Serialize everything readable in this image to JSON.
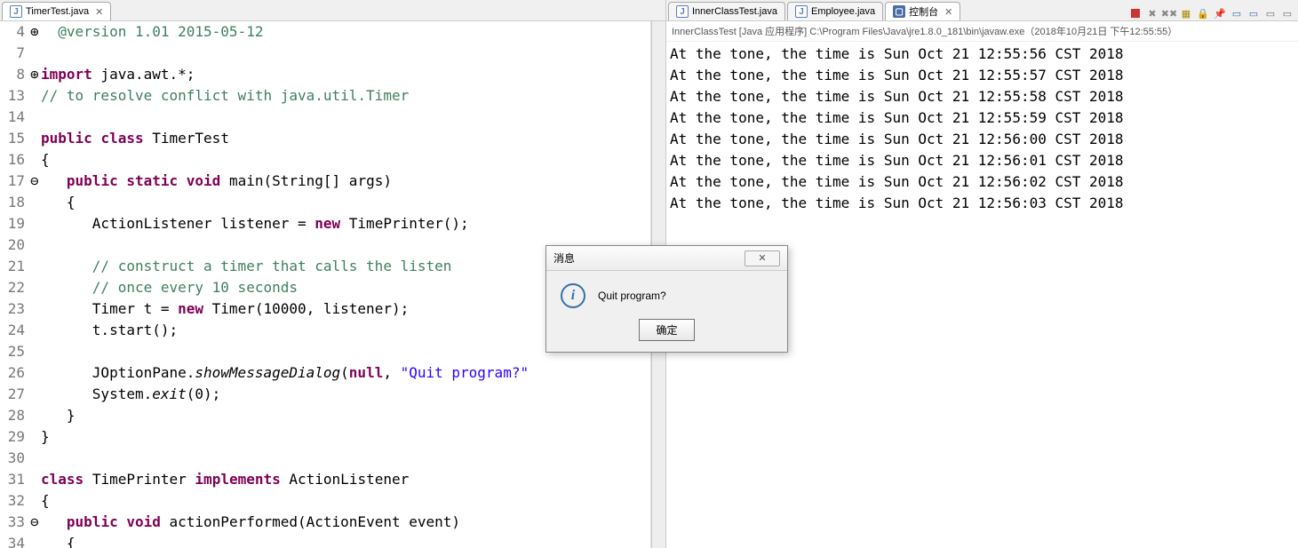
{
  "left": {
    "tab": {
      "label": "TimerTest.java"
    },
    "lineNumbers": " 4\n 7\n 8\n13\n14\n15\n16\n17\n18\n19\n20\n21\n22\n23\n24\n25\n26\n27\n28\n29\n30\n31\n32\n33\n34",
    "markers": "⊕\n \n⊕\n \n \n \n \n⊖\n \n \n \n \n \n \n \n \n \n \n \n \n \n \n \n⊖\n ",
    "code_html": "  <span class='cm'>@version 1.01 2015-05-12</span>\n\n<span class='kw'>import</span> java.awt.*;\n<span class='cm'>// to resolve conflict with java.util.Timer</span>\n\n<span class='kw'>public</span> <span class='kw'>class</span> <span class='cls'>TimerTest</span>\n{\n   <span class='kw'>public</span> <span class='kw'>static</span> <span class='kw'>void</span> main(String[] args)\n   {\n      ActionListener listener = <span class='kw'>new</span> TimePrinter();\n\n      <span class='cm'>// construct a timer that calls the listen</span>\n      <span class='cm'>// once every 10 seconds</span>\n      Timer t = <span class='kw'>new</span> Timer(10000, listener);\n      t.start();\n\n      JOptionPane.<span class='mth-i'>showMessageDialog</span>(<span class='kw'>null</span>, <span class='str'>\"Quit program?\"</span>\n      System.<span class='mth-i'>exit</span>(0);\n   }\n}\n\n<span class='kw'>class</span> <span class='cls'>TimePrinter</span> <span class='kw'>implements</span> ActionListener\n{\n   <span class='kw'>public</span> <span class='kw'>void</span> actionPerformed(ActionEvent event)\n   {"
  },
  "right": {
    "tabs": {
      "t1": "InnerClassTest.java",
      "t2": "Employee.java",
      "t3": "控制台"
    },
    "header": "InnerClassTest [Java 应用程序] C:\\Program Files\\Java\\jre1.8.0_181\\bin\\javaw.exe（2018年10月21日 下午12:55:55）",
    "lines": [
      "At the tone, the time is Sun Oct 21 12:55:56 CST 2018",
      "At the tone, the time is Sun Oct 21 12:55:57 CST 2018",
      "At the tone, the time is Sun Oct 21 12:55:58 CST 2018",
      "At the tone, the time is Sun Oct 21 12:55:59 CST 2018",
      "At the tone, the time is Sun Oct 21 12:56:00 CST 2018",
      "At the tone, the time is Sun Oct 21 12:56:01 CST 2018",
      "At the tone, the time is Sun Oct 21 12:56:02 CST 2018",
      "At the tone, the time is Sun Oct 21 12:56:03 CST 2018"
    ]
  },
  "dialog": {
    "title": "消息",
    "message": "Quit program?",
    "ok": "确定"
  }
}
